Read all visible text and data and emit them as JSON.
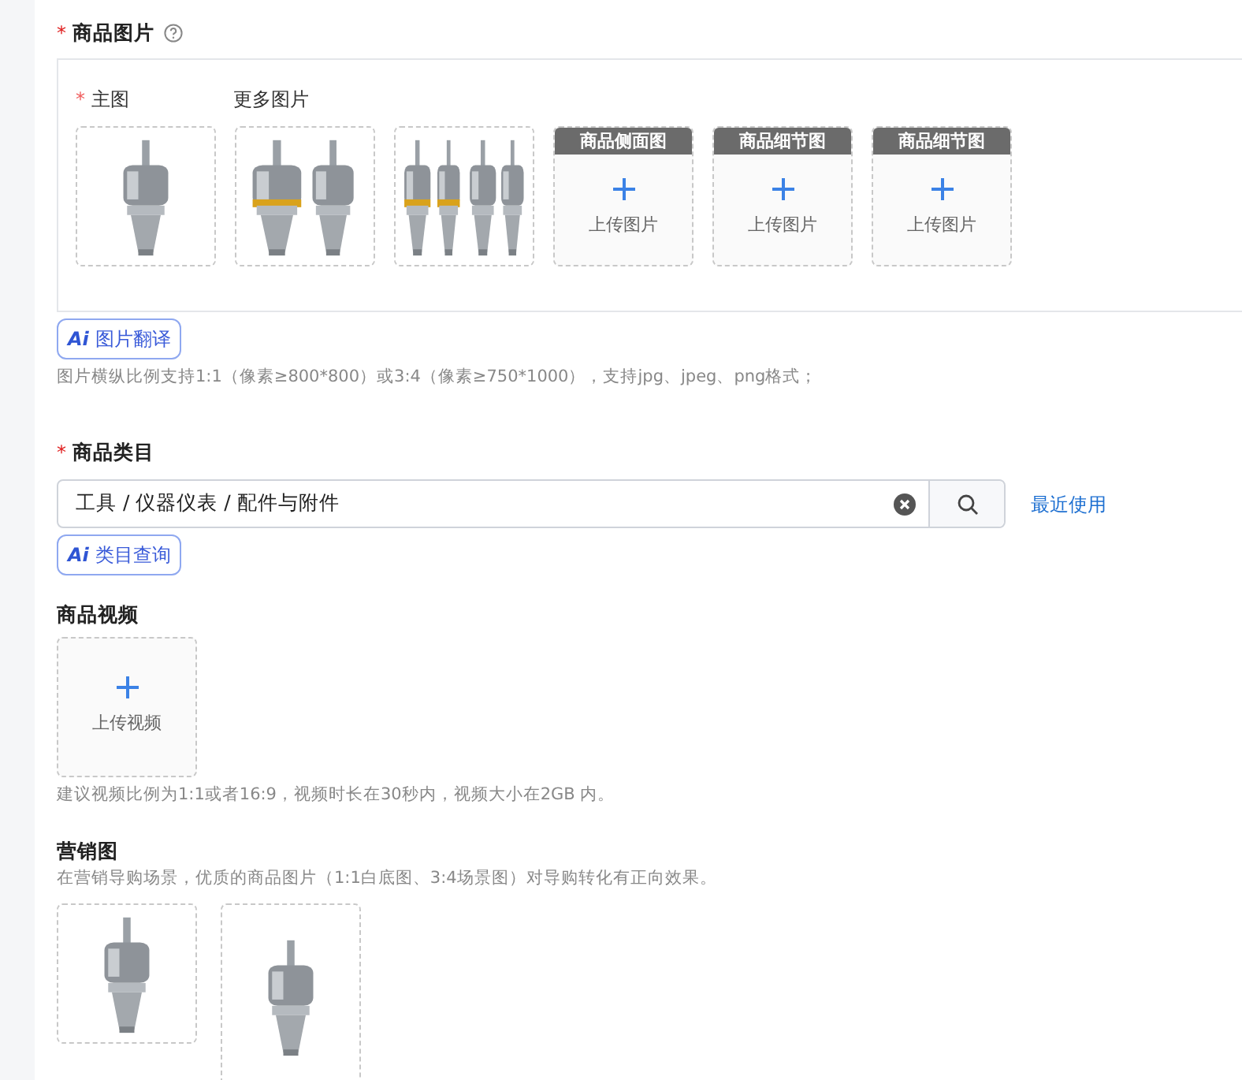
{
  "product_images": {
    "required_mark": "*",
    "label": "商品图片",
    "main_label": {
      "required_mark": "*",
      "text": "主图"
    },
    "more_label": "更多图片",
    "slots": [
      {
        "kind": "picture"
      },
      {
        "kind": "picture"
      },
      {
        "kind": "picture"
      },
      {
        "kind": "upload",
        "tag": "商品侧面图",
        "text": "上传图片"
      },
      {
        "kind": "upload",
        "tag": "商品细节图",
        "text": "上传图片"
      },
      {
        "kind": "upload",
        "tag": "商品细节图",
        "text": "上传图片"
      }
    ],
    "ai_button": {
      "badge": "Ai",
      "label": "图片翻译"
    },
    "hint": "图片横纵比例支持1:1（像素≥800*800）或3:4（像素≥750*1000），支持jpg、jpeg、png格式；"
  },
  "category": {
    "required_mark": "*",
    "label": "商品类目",
    "value": "工具 / 仪器仪表 / 配件与附件",
    "recent_link": "最近使用",
    "ai_button": {
      "badge": "Ai",
      "label": "类目查询"
    }
  },
  "video": {
    "label": "商品视频",
    "upload_text": "上传视频",
    "hint": "建议视频比例为1:1或者16:9，视频时长在30秒内，视频大小在2GB 内。"
  },
  "marketing": {
    "label": "营销图",
    "hint": "在营销导购场景，优质的商品图片（1:1白底图、3:4场景图）对导购转化有正向效果。",
    "images": [
      {
        "kind": "picture"
      },
      {
        "kind": "picture"
      }
    ]
  }
}
